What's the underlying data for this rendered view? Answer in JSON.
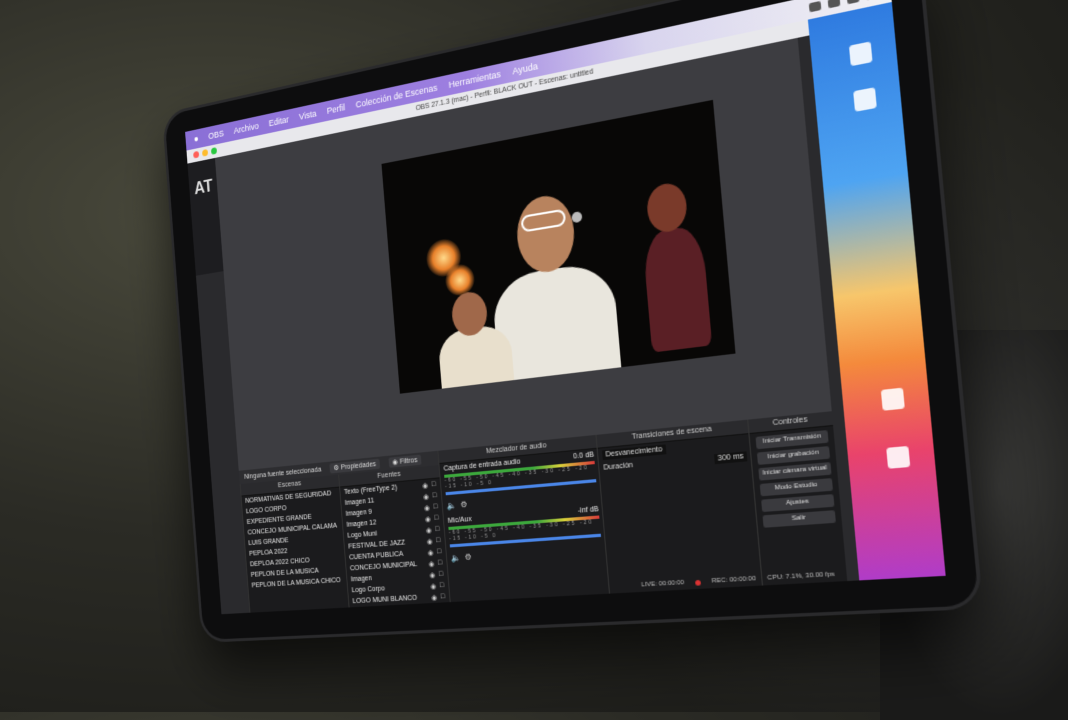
{
  "menubar": {
    "apple": "",
    "items": [
      "OBS",
      "Archivo",
      "Editar",
      "Vista",
      "Perfil",
      "Colección de Escenas",
      "Herramientas",
      "Ayuda"
    ]
  },
  "window": {
    "title": "OBS 27.1.3 (mac) - Perfil: BLACK OUT - Escenas: untitled",
    "light_colors": [
      "#ff5f57",
      "#febc2e",
      "#28c840"
    ]
  },
  "left_logo": "AT",
  "preview": {
    "description_colors": {
      "canvas": "#080706",
      "shirt": "#e9e6dd"
    }
  },
  "properties_bar": {
    "no_source": "Ninguna fuente seleccionada",
    "properties_label": "Propiedades",
    "filters_label": "Filtros"
  },
  "scenes": {
    "title": "Escenas",
    "items": [
      "NORMATIVAS DE SEGURIDAD",
      "LOGO CORPO",
      "EXPEDIENTE GRANDE",
      "CONCEJO MUNICIPAL CALAMA",
      "LUIS GRANDE",
      "PEPLOA 2022",
      "DEPLOA 2022 CHICO",
      "PEPLON DE LA MUSICA",
      "PEPLON DE LA MUSICA CHICO"
    ]
  },
  "sources": {
    "title": "Fuentes",
    "items": [
      "Texto (FreeType 2)",
      "Imagen 11",
      "Imagen 9",
      "Imagen 12",
      "Logo Muni",
      "FESTIVAL DE JAZZ",
      "CUENTA PÚBLICA",
      "CONCEJO MUNICIPAL",
      "Imagen",
      "Logo Corpo",
      "LOGO MUNI BLANCO"
    ]
  },
  "mixer": {
    "title": "Mezclador de audio",
    "channels": [
      {
        "name": "Captura de entrada audio",
        "db": "0.0 dB",
        "ticks": "-60 -55 -50 -45 -40 -35 -30 -25 -20 -15 -10 -5 0"
      },
      {
        "name": "Mic/Aux",
        "db": "-inf dB",
        "ticks": "-60 -55 -50 -45 -40 -35 -30 -25 -20 -15 -10 -5 0"
      }
    ]
  },
  "transitions": {
    "title": "Transiciones de escena",
    "type": "Desvanecimiento",
    "duration_label": "Duración",
    "duration_value": "300 ms"
  },
  "controls": {
    "title": "Controles",
    "buttons": [
      "Iniciar Transmisión",
      "Iniciar grabación",
      "Iniciar cámara virtual",
      "Modo Estudio",
      "Ajustes",
      "Salir"
    ]
  },
  "statusbar": {
    "live": "LIVE: 00:00:00",
    "rec": "REC: 00:00:00",
    "cpu": "CPU: 7.1%, 30.00 fps"
  }
}
